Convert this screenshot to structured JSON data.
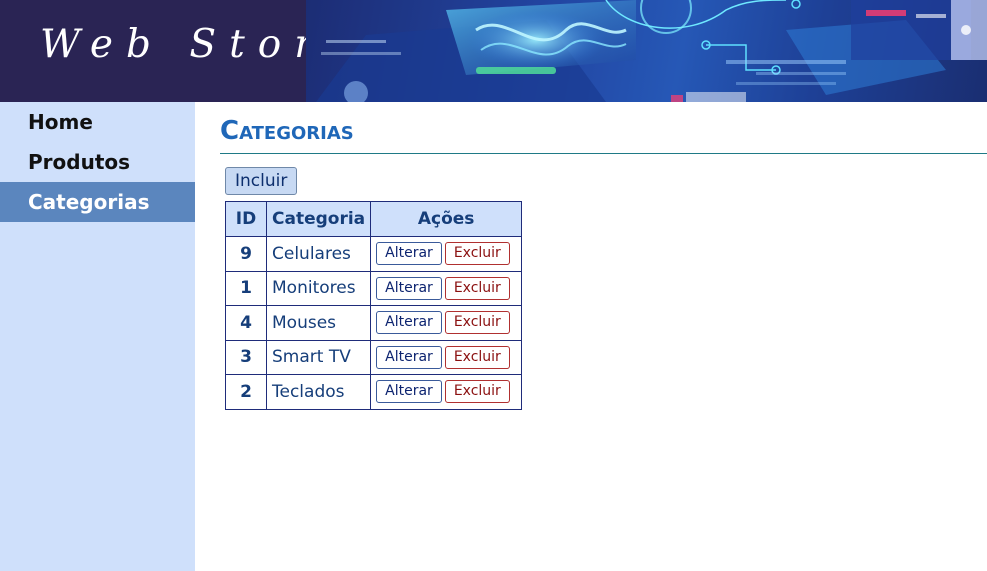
{
  "header": {
    "logo_text": "Web Store"
  },
  "sidebar": {
    "items": [
      {
        "label": "Home",
        "active": false
      },
      {
        "label": "Produtos",
        "active": false
      },
      {
        "label": "Categorias",
        "active": true
      }
    ]
  },
  "main": {
    "title": "Categorias",
    "include_label": "Incluir",
    "table": {
      "headers": [
        "ID",
        "Categoria",
        "Ações"
      ],
      "rows": [
        {
          "id": "9",
          "categoria": "Celulares"
        },
        {
          "id": "1",
          "categoria": "Monitores"
        },
        {
          "id": "4",
          "categoria": "Mouses"
        },
        {
          "id": "3",
          "categoria": "Smart TV"
        },
        {
          "id": "2",
          "categoria": "Teclados"
        }
      ],
      "edit_label": "Alterar",
      "delete_label": "Excluir"
    }
  },
  "colors": {
    "header_bg": "#27224f",
    "sidebar_bg": "#cfe0fb",
    "sidebar_active": "#5b86be",
    "title": "#1f67b8",
    "delete": "#8b1010"
  },
  "icons": [
    "tech-banner-image"
  ]
}
